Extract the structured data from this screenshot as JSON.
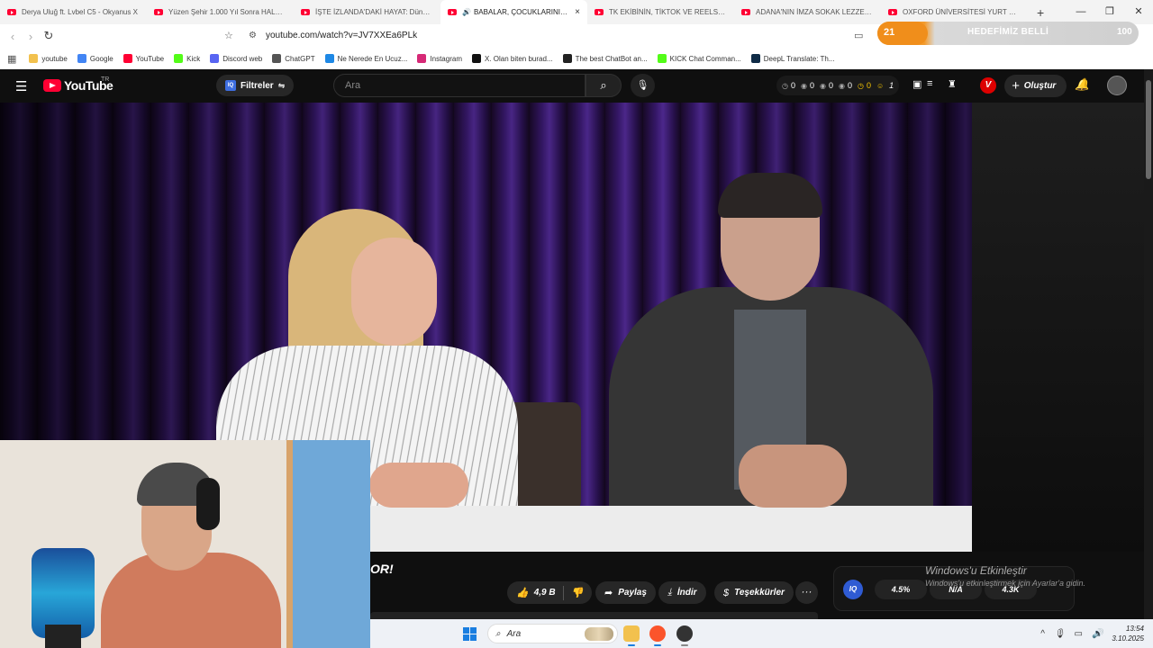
{
  "browser": {
    "tabs": [
      {
        "title": "Derya Uluğ ft. Lvbel C5 - Okyanus X",
        "active": false
      },
      {
        "title": "Yüzen Şehir 1.000 Yıl Sonra HALA N",
        "active": false
      },
      {
        "title": "İŞTE İZLANDA'DAKİ HAYAT: Dünyan",
        "active": false
      },
      {
        "title": "BABALAR, ÇOCUKLARININ Tİ",
        "active": true
      },
      {
        "title": "TK EKİBİNİN, TİKTOK VE REELS VİDEO",
        "active": false
      },
      {
        "title": "ADANA'NIN İMZA SOKAK LEZZETLE",
        "active": false
      },
      {
        "title": "OXFORD ÜNİVERSİTESİ YURT ODASI",
        "active": false
      }
    ],
    "new_tab": "+",
    "close_tab": "×",
    "window_controls": {
      "minimize": "—",
      "maximize": "❐",
      "close": "✕"
    },
    "url": "youtube.com/watch?v=JV7XXEa6PLk",
    "extension_banner": {
      "count": "21",
      "text": "HEDEFİMİZ BELLİ",
      "right_value": "100",
      "accent": "#f08e1b"
    },
    "bookmarks": [
      {
        "label": "youtube",
        "icon": "folder-icon",
        "color": "#f2c14e"
      },
      {
        "label": "Google",
        "icon": "google-icon",
        "color": "#4285f4"
      },
      {
        "label": "YouTube",
        "icon": "youtube-icon",
        "color": "#ff0033"
      },
      {
        "label": "Kick",
        "icon": "kick-icon",
        "color": "#53fc18"
      },
      {
        "label": "Discord web",
        "icon": "discord-icon",
        "color": "#5865f2"
      },
      {
        "label": "ChatGPT",
        "icon": "chatgpt-icon",
        "color": "#555555"
      },
      {
        "label": "Ne Nerede En Ucuz...",
        "icon": "checkmark-icon",
        "color": "#1e88e5"
      },
      {
        "label": "Instagram",
        "icon": "instagram-icon",
        "color": "#d62976"
      },
      {
        "label": "X. Olan biten burad...",
        "icon": "x-icon",
        "color": "#111111"
      },
      {
        "label": "The best ChatBot an...",
        "icon": "chatbot-icon",
        "color": "#222222"
      },
      {
        "label": "KICK Chat Comman...",
        "icon": "kick-icon",
        "color": "#53fc18"
      },
      {
        "label": "DeepL Translate: Th...",
        "icon": "deepl-icon",
        "color": "#0f2b46"
      }
    ]
  },
  "youtube": {
    "logo_text": "YouTube",
    "region": "TR",
    "filters_label": "Filtreler",
    "filters_badge": "IQ",
    "search_placeholder": "Ara",
    "stats": [
      "0",
      "0",
      "0",
      "0",
      "0",
      "1"
    ],
    "v_badge": "V",
    "create_label": "Oluştur",
    "accent": "#ff0033"
  },
  "video": {
    "title_tail": "OR!",
    "likes": "4,9 B",
    "share_label": "Paylaş",
    "download_label": "İndir",
    "thanks_label": "Teşekkürler",
    "more_label": "···"
  },
  "iq_panel": {
    "badge": "IQ",
    "values": [
      "4.5%",
      "N/A",
      "4.3K"
    ]
  },
  "windows_notice": {
    "title": "Windows'u Etkinleştir",
    "subtitle": "Windows'u etkinleştirmek için Ayarlar'a gidin."
  },
  "taskbar": {
    "search_label": "Ara",
    "time": "13:54",
    "date": "3.10.2025"
  }
}
